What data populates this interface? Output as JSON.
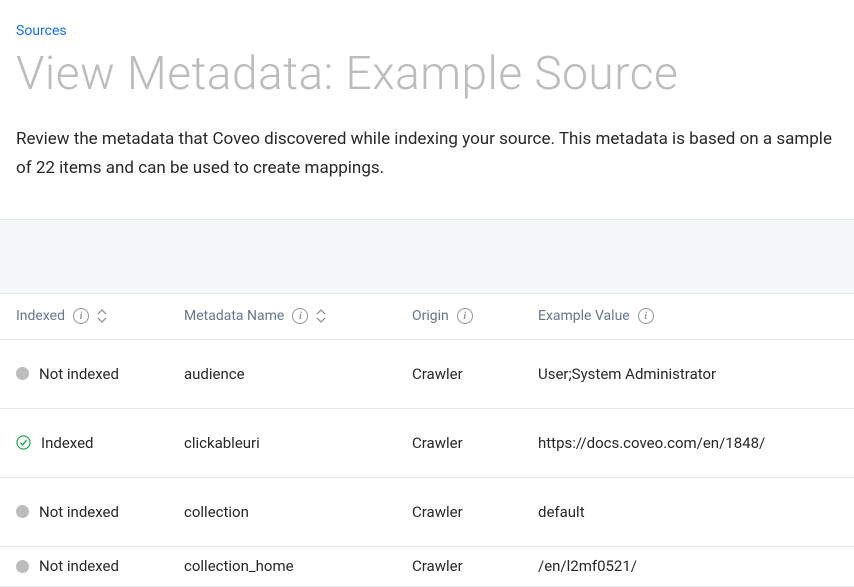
{
  "breadcrumb": "Sources",
  "title": "View Metadata: Example Source",
  "description": "Review the metadata that Coveo discovered while indexing your source. This metadata is based on a sample of 22 items and can be used to create mappings.",
  "columns": {
    "indexed": "Indexed",
    "metadata_name": "Metadata Name",
    "origin": "Origin",
    "example_value": "Example Value"
  },
  "rows": [
    {
      "status": "not_indexed",
      "status_label": "Not indexed",
      "name": "audience",
      "origin": "Crawler",
      "example": "User;System Administrator"
    },
    {
      "status": "indexed",
      "status_label": "Indexed",
      "name": "clickableuri",
      "origin": "Crawler",
      "example": "https://docs.coveo.com/en/1848/"
    },
    {
      "status": "not_indexed",
      "status_label": "Not indexed",
      "name": "collection",
      "origin": "Crawler",
      "example": "default"
    },
    {
      "status": "not_indexed",
      "status_label": "Not indexed",
      "name": "collection_home",
      "origin": "Crawler",
      "example": "/en/l2mf0521/"
    }
  ]
}
